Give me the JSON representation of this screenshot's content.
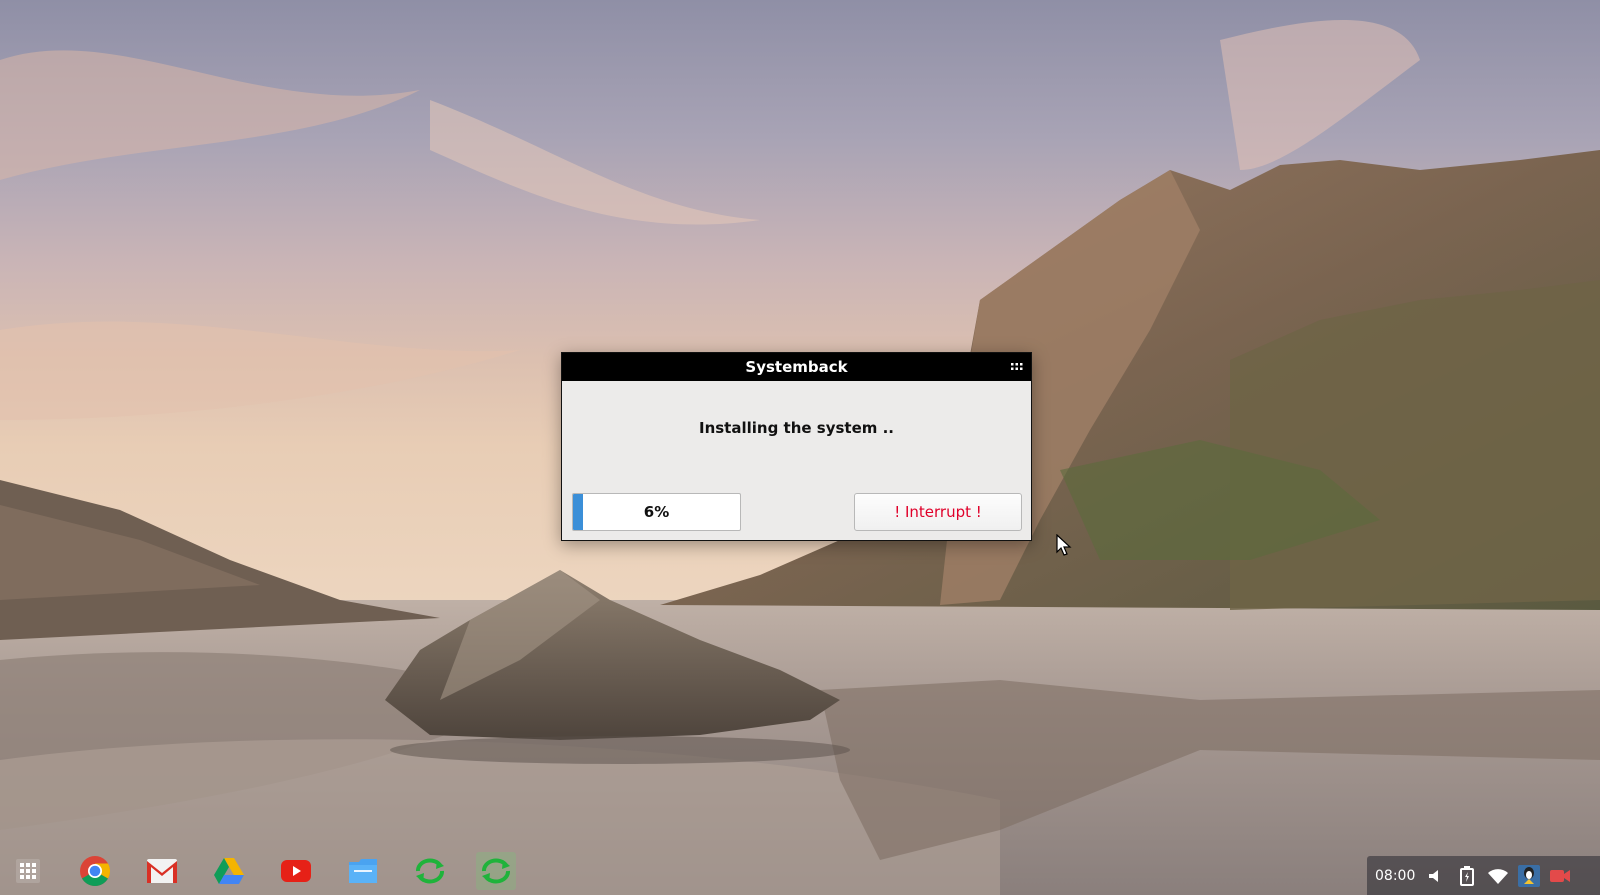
{
  "dialog": {
    "title": "Systemback",
    "menu_icon": "grid-menu-icon",
    "message": "Installing the system ..",
    "progress": {
      "value_percent": 6,
      "label": "6%"
    },
    "interrupt_label": "! Interrupt !",
    "interrupt_color": "#e0002a"
  },
  "shelf": {
    "items": [
      {
        "name": "app-launcher",
        "icon": "app-launcher-grid-icon"
      },
      {
        "name": "chrome",
        "icon": "chrome-icon"
      },
      {
        "name": "gmail",
        "icon": "gmail-icon"
      },
      {
        "name": "google-drive",
        "icon": "google-drive-icon"
      },
      {
        "name": "youtube",
        "icon": "youtube-icon"
      },
      {
        "name": "files",
        "icon": "files-icon"
      },
      {
        "name": "systemback",
        "icon": "sync-arrows-icon"
      },
      {
        "name": "systemback-active",
        "icon": "sync-arrows-icon",
        "active": true
      }
    ]
  },
  "status_area": {
    "time": "08:00",
    "icons": [
      "volume-icon",
      "battery-icon",
      "wifi-icon",
      "user-avatar-icon",
      "screen-record-icon"
    ]
  },
  "colors": {
    "titlebar": "#000000",
    "dialog_bg": "#ecebea",
    "progress_fill": "#3b8fd8"
  }
}
